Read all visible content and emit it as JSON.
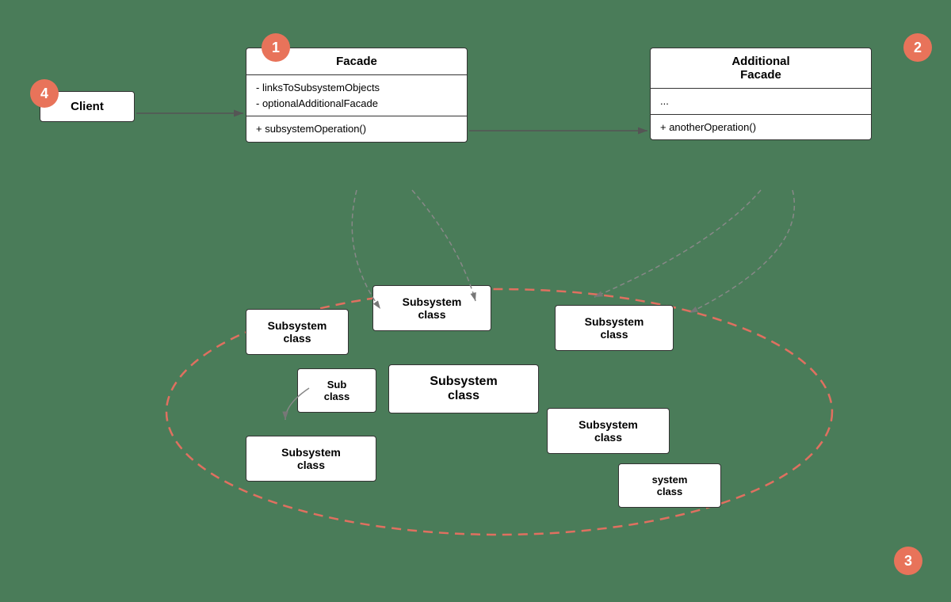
{
  "numbers": {
    "n1": "1",
    "n2": "2",
    "n3": "3",
    "n4": "4"
  },
  "client": {
    "label": "Client"
  },
  "facade": {
    "title": "Facade",
    "field1": "- linksToSubsystemObjects",
    "field2": "- optionalAdditionalFacade",
    "method": "+ subsystemOperation()"
  },
  "additionalFacade": {
    "title": "Additional Facade",
    "field": "...",
    "method": "+ anotherOperation()"
  },
  "subsystemClasses": [
    {
      "id": "sub1",
      "label": "Subsystem\nclass"
    },
    {
      "id": "sub2",
      "label": "Subsystem\nclass"
    },
    {
      "id": "sub3",
      "label": "Subsystem\nclass"
    },
    {
      "id": "sub4",
      "label": "Subsystem\nclass"
    },
    {
      "id": "sub5",
      "label": "Subsystem\nclass"
    },
    {
      "id": "sub6",
      "label": "Subsystem\nclass"
    },
    {
      "id": "sub7",
      "label": "Subsystem\nclass"
    }
  ],
  "colors": {
    "coral": "#e8735a",
    "green": "#4a7c59",
    "dashed": "#e07060"
  }
}
